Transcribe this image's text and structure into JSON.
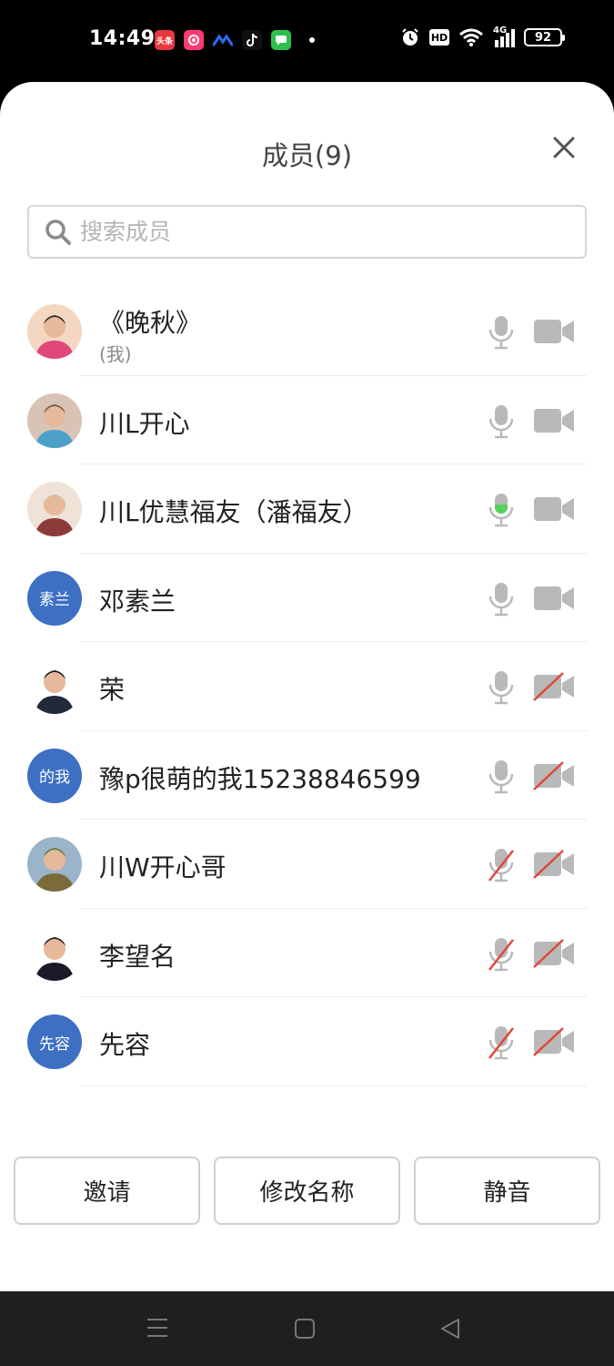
{
  "status_bar": {
    "time": "14:49",
    "app_icons": [
      {
        "name": "toutiao-app-icon",
        "label": "头条",
        "color": "#e8383d"
      },
      {
        "name": "video-app-icon",
        "label": "",
        "color": "#ff3a74"
      },
      {
        "name": "tencent-meeting-icon",
        "label": "",
        "color": "#2b6cf6"
      },
      {
        "name": "tiktok-icon",
        "label": "",
        "color": "#000000"
      },
      {
        "name": "message-app-icon",
        "label": "",
        "color": "#2fbf4d"
      }
    ],
    "indicators": [
      "HD",
      "4G"
    ],
    "battery": "92"
  },
  "dialog": {
    "title": "成员(9)",
    "search_placeholder": "搜索成员"
  },
  "members": [
    {
      "name": "《晚秋》",
      "sub": "(我)",
      "avatar": "photo",
      "avatar_text": "",
      "mic": "on",
      "camera": "on"
    },
    {
      "name": "川L开心",
      "sub": "",
      "avatar": "photo",
      "avatar_text": "",
      "mic": "on",
      "camera": "on"
    },
    {
      "name": "川L优慧福友（潘福友）",
      "sub": "",
      "avatar": "photo",
      "avatar_text": "",
      "mic": "speaking",
      "camera": "on"
    },
    {
      "name": "邓素兰",
      "sub": "",
      "avatar": "text",
      "avatar_text": "素兰",
      "mic": "on",
      "camera": "on"
    },
    {
      "name": "荣",
      "sub": "",
      "avatar": "photo",
      "avatar_text": "",
      "mic": "on",
      "camera": "off"
    },
    {
      "name": "豫p很萌的我15238846599",
      "sub": "",
      "avatar": "text",
      "avatar_text": "的我",
      "mic": "on",
      "camera": "off"
    },
    {
      "name": "川W开心哥",
      "sub": "",
      "avatar": "photo",
      "avatar_text": "",
      "mic": "off",
      "camera": "off"
    },
    {
      "name": "李望名",
      "sub": "",
      "avatar": "photo",
      "avatar_text": "",
      "mic": "off",
      "camera": "off"
    },
    {
      "name": "先容",
      "sub": "",
      "avatar": "text",
      "avatar_text": "先容",
      "mic": "off",
      "camera": "off"
    }
  ],
  "actions": {
    "invite": "邀请",
    "rename": "修改名称",
    "mute": "静音"
  },
  "colors": {
    "avatar_blue": "#3d6fc3",
    "icon_gray": "#b9b9b9",
    "muted_red": "#e0483a",
    "speaking_green": "#58d25c"
  }
}
